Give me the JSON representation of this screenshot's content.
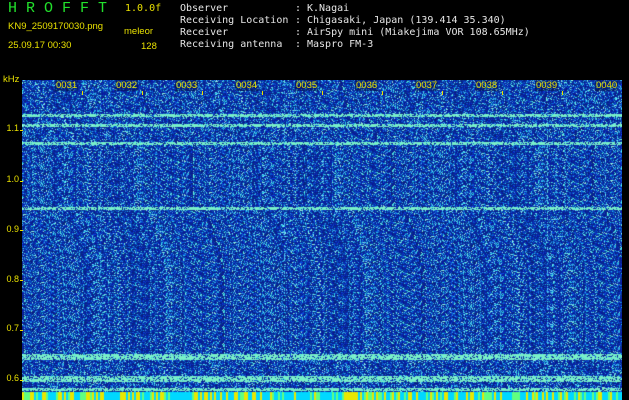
{
  "header": {
    "app_title": "HROFFT",
    "version": "1.0.0f",
    "filename": "KN9_2509170030.png",
    "mode": "meleor",
    "datetime": "25.09.17 00:30",
    "fft_points": "128"
  },
  "station_info": [
    {
      "label": "Observer",
      "value": "K.Nagai"
    },
    {
      "label": "Receiving Location",
      "value": "Chigasaki, Japan (139.414 35.340)"
    },
    {
      "label": "Receiver",
      "value": "AirSpy mini (Miakejima VOR 108.65MHz)"
    },
    {
      "label": "Receiving antenna",
      "value": "Maspro FM-3"
    }
  ],
  "y_axis": {
    "unit": "kHz",
    "ticks": [
      "1.1",
      "1.0",
      "0.9",
      "0.8",
      "0.7",
      "0.6"
    ]
  },
  "x_axis": {
    "ticks": [
      "0031",
      "0032",
      "0033",
      "0034",
      "0035",
      "0036",
      "0037",
      "0038",
      "0039",
      "0040"
    ]
  },
  "colors": {
    "background": "#000000",
    "label_yellow": "#e8e000",
    "title_green": "#22e02c",
    "spectrogram_base": "#1020a8",
    "noise_cyan": "#40d0ff",
    "carrier_line": "#60ffc0"
  }
}
